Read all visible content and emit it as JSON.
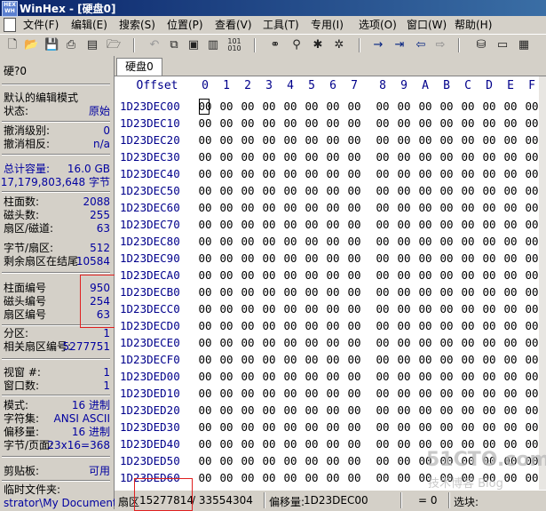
{
  "title": "WinHex - [硬盘0]",
  "menu": [
    "文件(F)",
    "编辑(E)",
    "搜索(S)",
    "位置(P)",
    "查看(V)",
    "工具(T)",
    "专用(I)",
    "选项(O)",
    "窗口(W)",
    "帮助(H)"
  ],
  "toolbar_icons": [
    "new-file-icon",
    "open-icon",
    "save-icon",
    "print-icon",
    "properties-icon",
    "open-folder-icon",
    "undo-icon",
    "copy-icon",
    "paste-icon",
    "clipboard-icon",
    "hex-convert-icon",
    "binoculars-icon",
    "find-hex-icon",
    "replace-icon",
    "replace-hex-icon",
    "goto-icon",
    "goto-offset-icon",
    "back-icon",
    "forward-icon",
    "disk-icon",
    "disk-edit-icon",
    "ram-icon"
  ],
  "left": {
    "title": "硬?0",
    "mode_label": "默认的编辑模式",
    "state_label": "状态:",
    "state_value": "原始",
    "undo_level_label": "撤消级别:",
    "undo_level_value": "0",
    "undo_reverse_label": "撤消相反:",
    "undo_reverse_value": "n/a",
    "capacity_label": "总计容量:",
    "capacity_value": "16.0 GB",
    "capacity_bytes": "17,179,803,648 字节",
    "cylinders_label": "柱面数:",
    "cylinders_value": "2088",
    "heads_label": "磁头数:",
    "heads_value": "255",
    "sectors_track_label": "扇区/磁道:",
    "sectors_track_value": "63",
    "bytes_sector_label": "字节/扇区:",
    "bytes_sector_value": "512",
    "remaining_label": "剩余扇区在结尾:",
    "remaining_value": "10584",
    "cyl_no_label": "柱面编号",
    "cyl_no_value": "950",
    "head_no_label": "磁头编号",
    "head_no_value": "254",
    "sector_no_label": "扇区编号",
    "sector_no_value": "63",
    "partition_label": "分区:",
    "partition_value": "1",
    "rel_sector_label": "相关扇区编号:",
    "rel_sector_value": "5277751",
    "window_no_label": "视窗 #:",
    "window_no_value": "1",
    "window_count_label": "窗口数:",
    "window_count_value": "1",
    "mode2_label": "模式:",
    "mode2_value": "16 进制",
    "charset_label": "字符集:",
    "charset_value": "ANSI ASCII",
    "offset_label": "偏移量:",
    "offset_value": "16 进制",
    "bytes_page_label": "字节/页面:",
    "bytes_page_value": "23x16=368",
    "clipboard_label": "剪贴板:",
    "clipboard_value": "可用",
    "temp_label": "临时文件夹:",
    "temp_value": "strator\\My Documents"
  },
  "tab": "硬盘0",
  "hex": {
    "offset_header": "Offset",
    "columns": [
      "0",
      "1",
      "2",
      "3",
      "4",
      "5",
      "6",
      "7",
      "8",
      "9",
      "A",
      "B",
      "C",
      "D",
      "E",
      "F"
    ],
    "rows": [
      "1D23DEC00",
      "1D23DEC10",
      "1D23DEC20",
      "1D23DEC30",
      "1D23DEC40",
      "1D23DEC50",
      "1D23DEC60",
      "1D23DEC70",
      "1D23DEC80",
      "1D23DEC90",
      "1D23DECA0",
      "1D23DECB0",
      "1D23DECC0",
      "1D23DECD0",
      "1D23DECE0",
      "1D23DECF0",
      "1D23DED00",
      "1D23DED10",
      "1D23DED20",
      "1D23DED30",
      "1D23DED40",
      "1D23DED50",
      "1D23DED60"
    ],
    "byte": "00"
  },
  "status": {
    "sector_label": "扇区",
    "sector_value": "15277814",
    "sector_total": "/ 33554304",
    "offset_label": "偏移量:",
    "offset_value": "1D23DEC00",
    "eq": "= 0",
    "select_label": "选块:"
  },
  "watermark": "51CTO.com",
  "watermark_sub": "技术博客 Blog"
}
